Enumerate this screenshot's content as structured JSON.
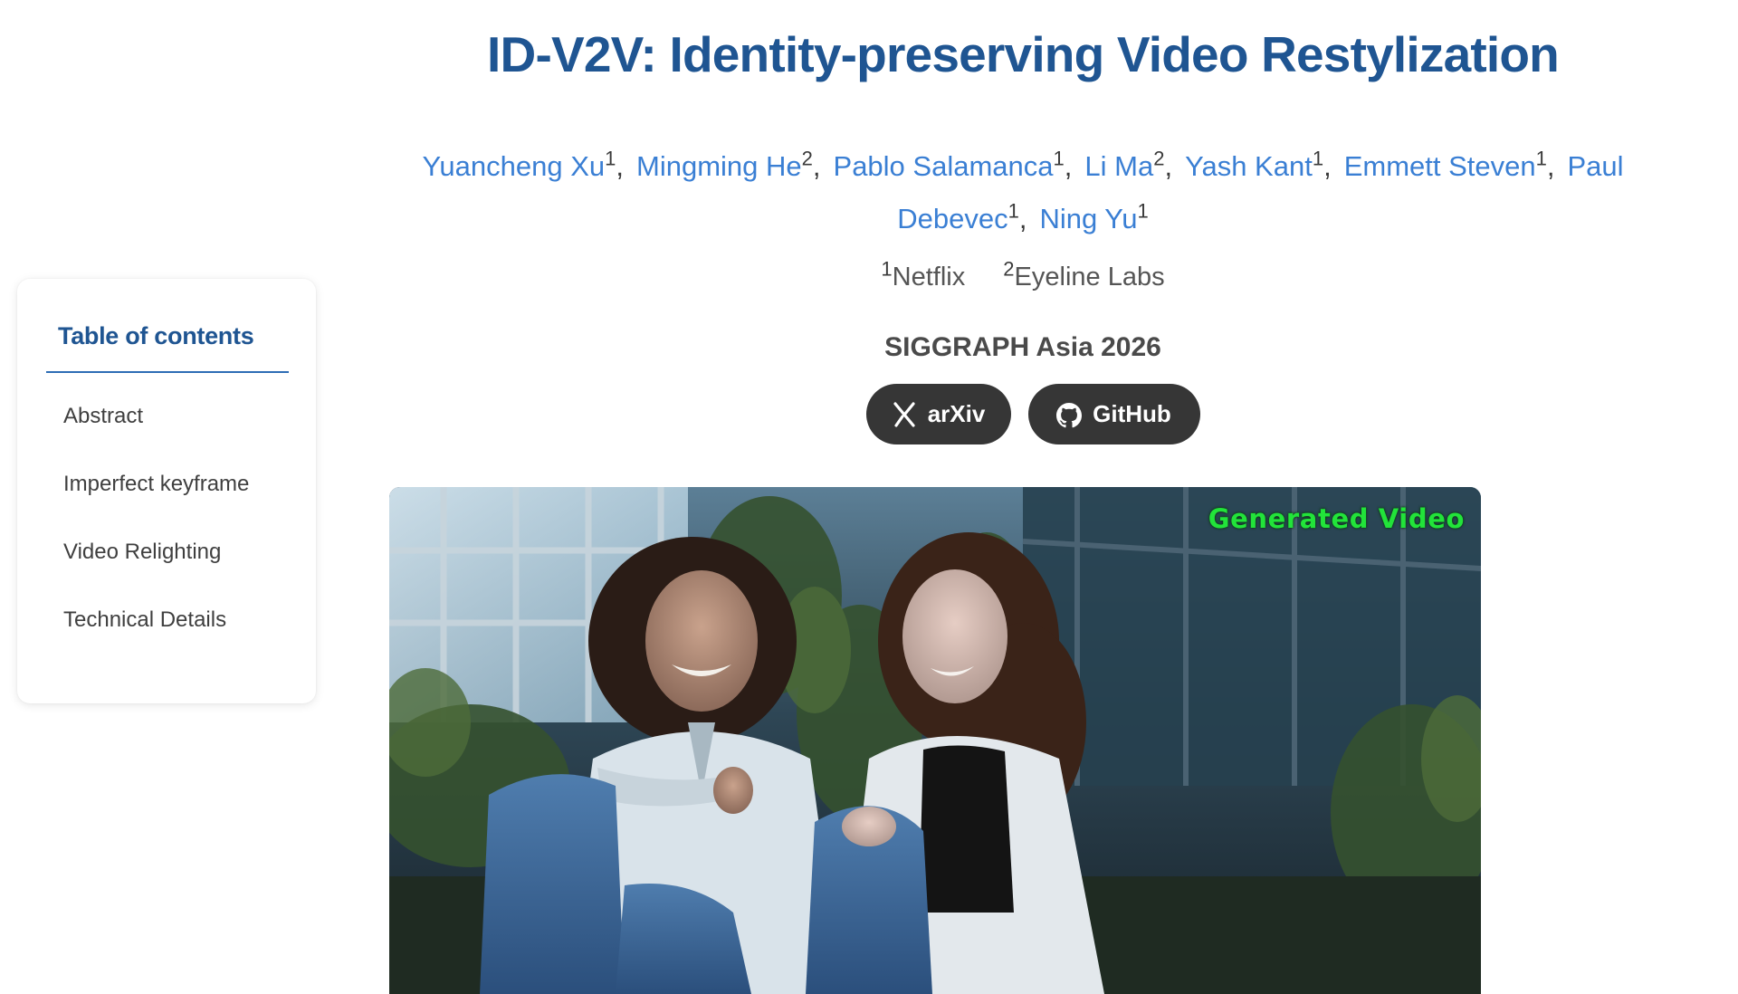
{
  "toc": {
    "title": "Table of contents",
    "items": [
      {
        "label": "Abstract"
      },
      {
        "label": "Imperfect keyframe"
      },
      {
        "label": "Video Relighting"
      },
      {
        "label": "Technical Details"
      }
    ]
  },
  "paper": {
    "title": "ID-V2V: Identity-preserving Video Restylization",
    "authors": [
      {
        "name": "Yuancheng Xu",
        "affil": "1"
      },
      {
        "name": "Mingming He",
        "affil": "2"
      },
      {
        "name": "Pablo Salamanca",
        "affil": "1"
      },
      {
        "name": "Li Ma",
        "affil": "2"
      },
      {
        "name": "Yash Kant",
        "affil": "1"
      },
      {
        "name": "Emmett Steven",
        "affil": "1"
      },
      {
        "name": "Paul Debevec",
        "affil": "1"
      },
      {
        "name": "Ning Yu",
        "affil": "1"
      }
    ],
    "author_split": {
      "first_line_end": "Paul",
      "second_line_start": "Debevec"
    },
    "separator": ",",
    "affiliations": [
      {
        "num": "1",
        "name": "Netflix"
      },
      {
        "num": "2",
        "name": "Eyeline Labs"
      }
    ],
    "venue": "SIGGRAPH Asia 2026",
    "links": [
      {
        "label": "arXiv",
        "icon": "arxiv-x-icon"
      },
      {
        "label": "GitHub",
        "icon": "github-octocat-icon"
      }
    ]
  },
  "video": {
    "overlay_label": "Generated Video",
    "overlay_color": "#22e33a"
  },
  "colors": {
    "title": "#1f5592",
    "author_link": "#3a7fd4",
    "pill_bg": "#363636",
    "toc_rule": "#2d6db5"
  }
}
